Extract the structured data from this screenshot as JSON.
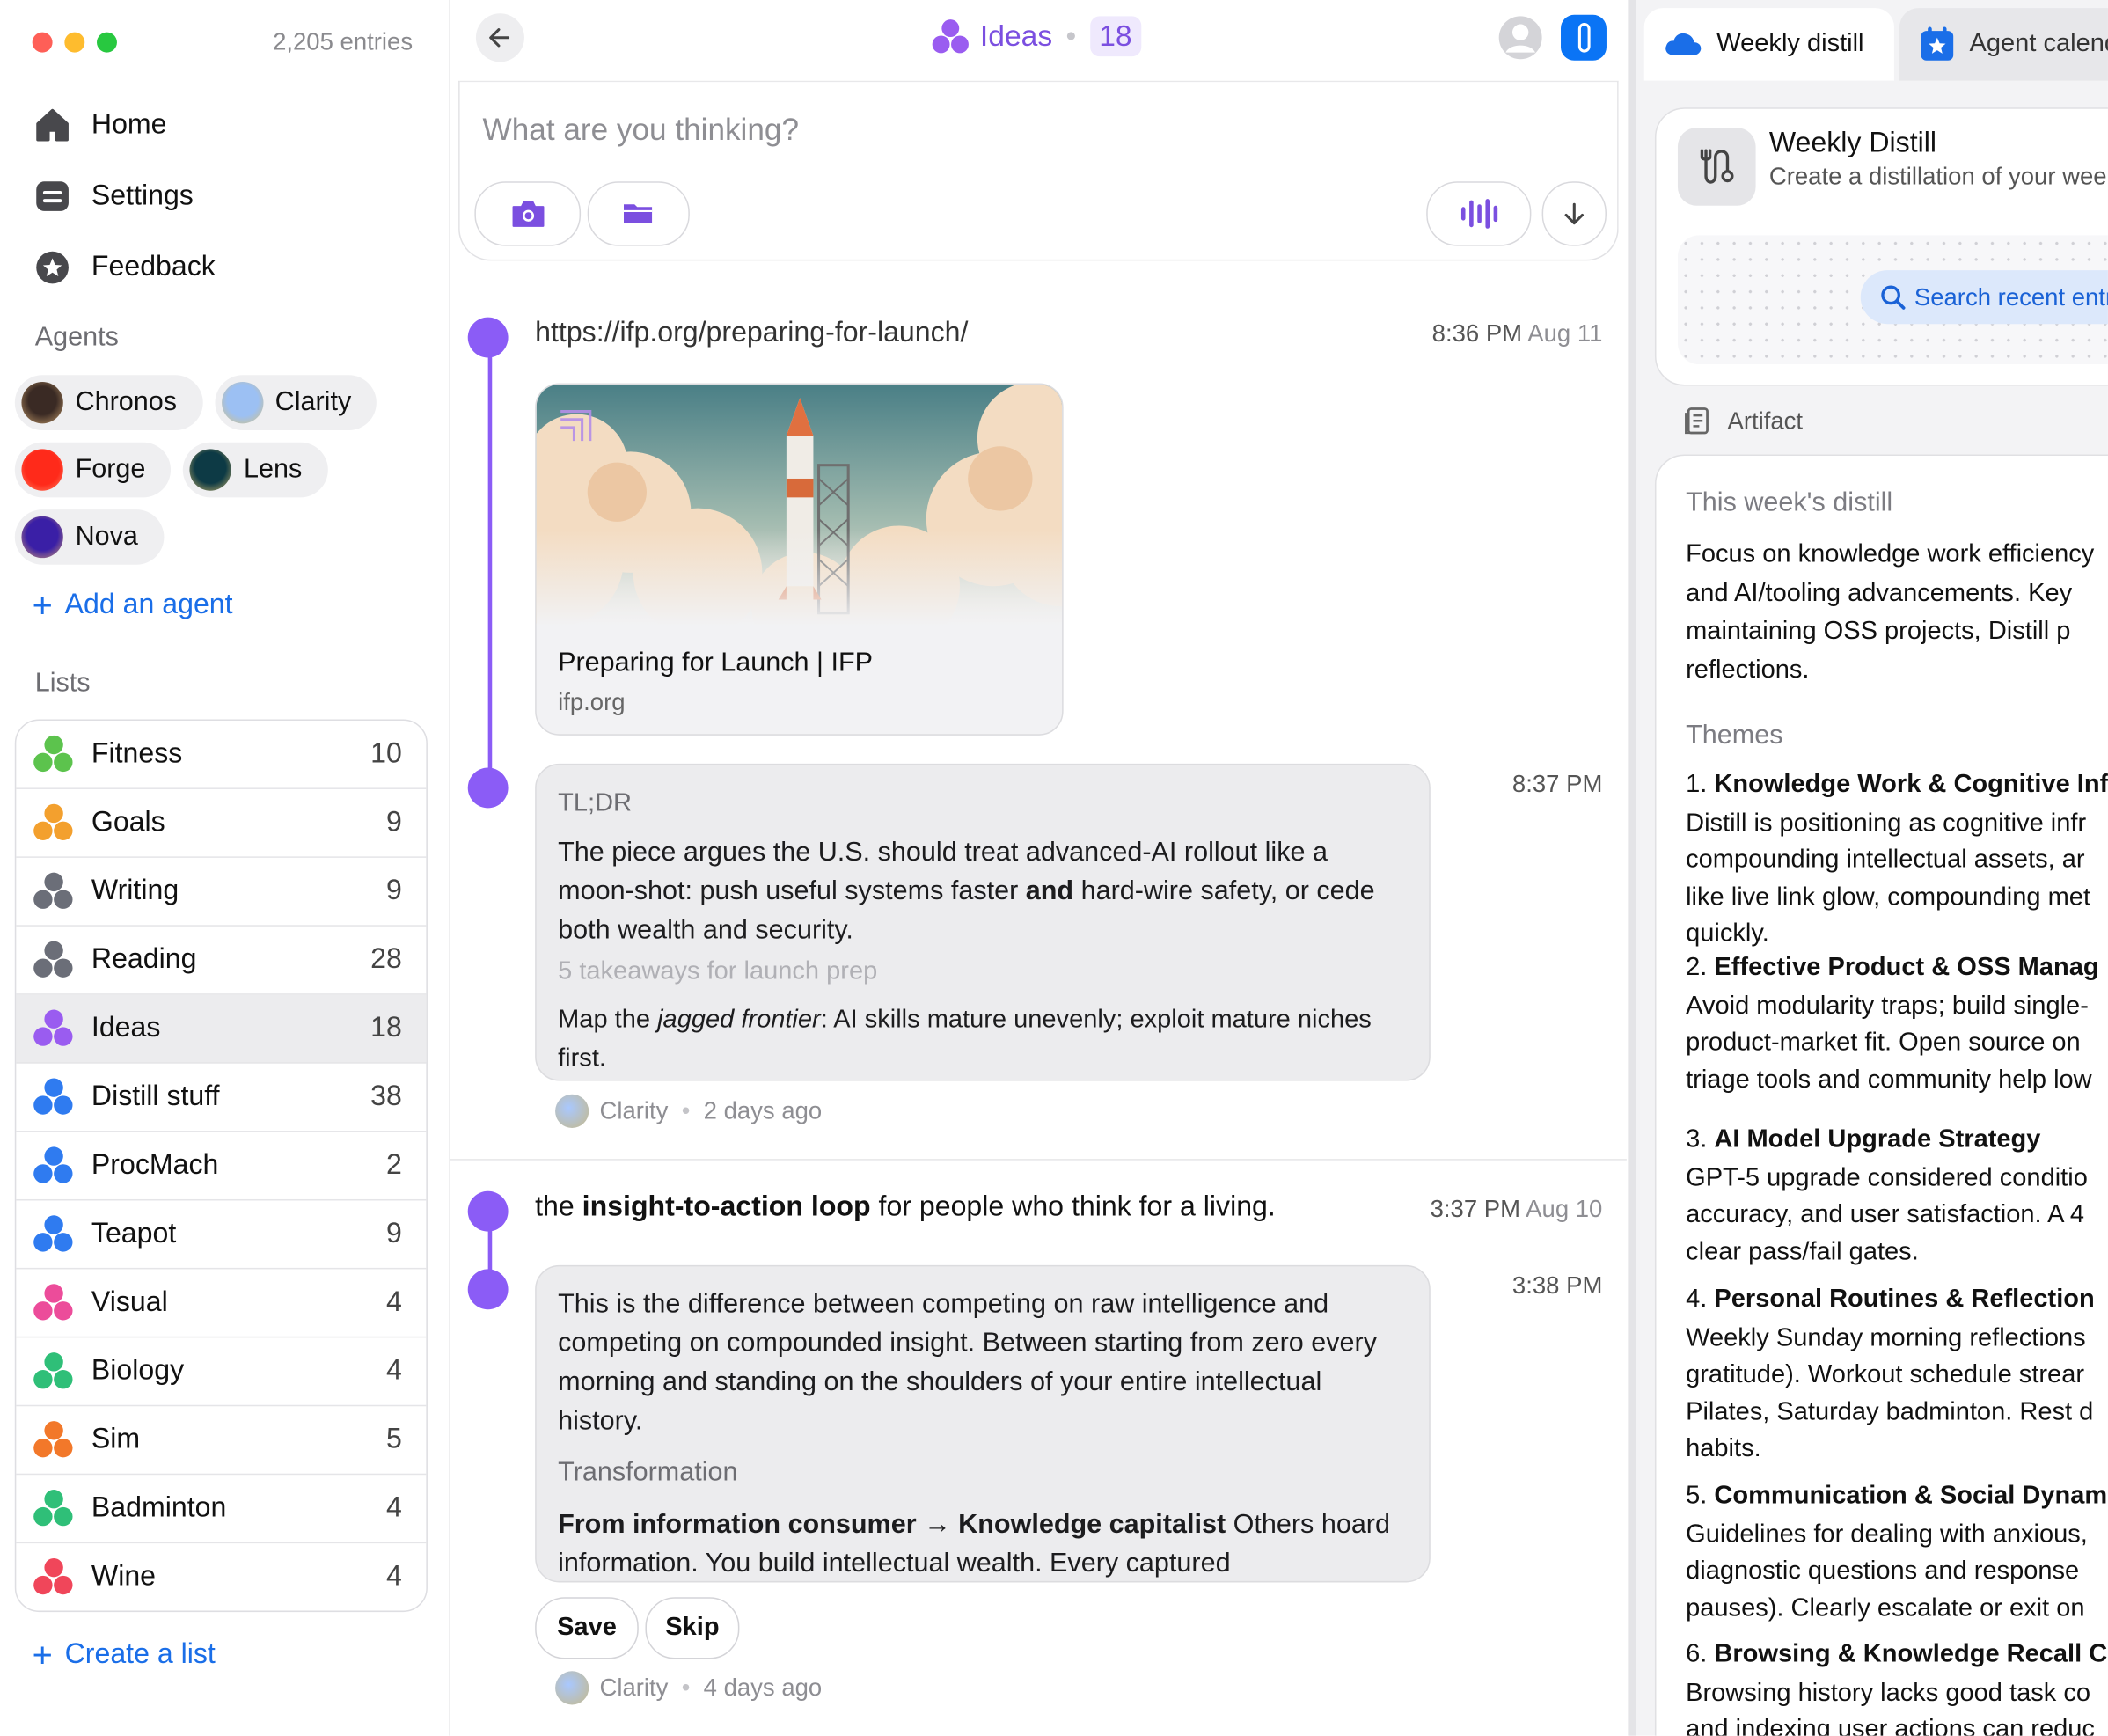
{
  "sidebar": {
    "entries": "2,205 entries",
    "nav": [
      "Home",
      "Settings",
      "Feedback"
    ],
    "agents_label": "Agents",
    "agents": [
      {
        "name": "Chronos",
        "color": "#4a3a32"
      },
      {
        "name": "Clarity",
        "color": "#9dbff0"
      },
      {
        "name": "Forge",
        "color": "#ff2d1f"
      },
      {
        "name": "Lens",
        "color": "#0f4250"
      },
      {
        "name": "Nova",
        "color": "#3b22a8"
      }
    ],
    "add_agent": "Add an agent",
    "lists_label": "Lists",
    "lists": [
      {
        "name": "Fitness",
        "count": "10",
        "color": "#5cc34d"
      },
      {
        "name": "Goals",
        "count": "9",
        "color": "#f3a02e"
      },
      {
        "name": "Writing",
        "count": "9",
        "color": "#6b6e78"
      },
      {
        "name": "Reading",
        "count": "28",
        "color": "#6b6e78"
      },
      {
        "name": "Ideas",
        "count": "18",
        "color": "#9a5cf0"
      },
      {
        "name": "Distill stuff",
        "count": "38",
        "color": "#2f7bf0"
      },
      {
        "name": "ProcMach",
        "count": "2",
        "color": "#2f7bf0"
      },
      {
        "name": "Teapot",
        "count": "9",
        "color": "#2f7bf0"
      },
      {
        "name": "Visual",
        "count": "4",
        "color": "#ec4c9a"
      },
      {
        "name": "Biology",
        "count": "4",
        "color": "#2fbf78"
      },
      {
        "name": "Sim",
        "count": "5",
        "color": "#f2782a"
      },
      {
        "name": "Badminton",
        "count": "4",
        "color": "#2fbf78"
      },
      {
        "name": "Wine",
        "count": "4",
        "color": "#f0465a"
      }
    ],
    "create_list": "Create a list"
  },
  "main": {
    "title": "Ideas",
    "count": "18",
    "composer_placeholder": "What are you thinking?",
    "entry1": {
      "url": "https://ifp.org/preparing-for-launch/",
      "time": "8:36 PM",
      "date": "Aug 11",
      "card_title": "Preparing for Launch | IFP",
      "card_domain": "ifp.org"
    },
    "reply1": {
      "time": "8:37 PM",
      "label": "TL;DR",
      "body_a": "The piece argues the U.S. should treat advanced-AI rollout like a moon-shot: push useful systems faster ",
      "body_b": "and",
      "body_c": " hard-wire safety, or cede both wealth and security.",
      "sub_heading": "5 takeaways for launch prep",
      "faded_a": "Map the ",
      "faded_b": "jagged frontier",
      "faded_c": ": AI skills mature unevenly; exploit mature niches first.",
      "agent": "Clarity",
      "ago": "2 days ago"
    },
    "entry2": {
      "pre": "the ",
      "bold": "insight-to-action loop",
      "post": " for people who think for a living.",
      "time": "3:37 PM",
      "date": "Aug 10"
    },
    "reply2": {
      "time": "3:38 PM",
      "body": "This is the difference between competing on raw intelligence and competing on compounded insight. Between starting from zero every morning and standing on the shoulders of your entire intellectual history.",
      "label": "Transformation",
      "faded_bold": "From information consumer → Knowledge capitalist",
      "faded_rest": " Others hoard information. You build intellectual wealth. Every captured",
      "save": "Save",
      "skip": "Skip",
      "agent": "Clarity",
      "ago": "4 days ago"
    }
  },
  "right": {
    "tab_active": "Weekly distill",
    "tab_other": "Agent calendar",
    "card_title": "Weekly Distill",
    "card_sub": "Create a distillation of your week",
    "search_label": "Search recent entries",
    "artifact": "Artifact",
    "distill_heading": "This week's distill",
    "intro": [
      "Focus on knowledge work efficiency",
      "and AI/tooling advancements. Key",
      "maintaining OSS projects, Distill p",
      "reflections."
    ],
    "themes_label": "Themes",
    "themes": [
      {
        "num": "1.",
        "title": "Knowledge Work & Cognitive Inf",
        "lines": [
          "Distill is positioning as cognitive infr",
          "compounding intellectual assets, ar",
          "like live link glow, compounding met",
          "quickly."
        ]
      },
      {
        "num": "2.",
        "title": "Effective Product & OSS Manag",
        "lines": [
          "Avoid modularity traps; build single-",
          "product-market fit. Open source on",
          "triage tools and community help low"
        ]
      },
      {
        "num": "3.",
        "title": "AI Model Upgrade Strategy",
        "lines": [
          "GPT-5 upgrade considered conditio",
          "accuracy, and user satisfaction. A 4",
          "clear pass/fail gates."
        ]
      },
      {
        "num": "4.",
        "title": "Personal Routines & Reflection",
        "lines": [
          "Weekly Sunday morning reflections",
          "gratitude). Workout schedule strear",
          "Pilates, Saturday badminton. Rest d",
          "habits."
        ]
      },
      {
        "num": "5.",
        "title": "Communication & Social Dynam",
        "lines": [
          "Guidelines for dealing with anxious,",
          "diagnostic questions and response",
          "pauses). Clearly escalate or exit on"
        ]
      },
      {
        "num": "6.",
        "title": "Browsing & Knowledge Recall C",
        "lines": [
          "Browsing history lacks good task co",
          "and indexing user actions can reduc"
        ]
      }
    ]
  }
}
